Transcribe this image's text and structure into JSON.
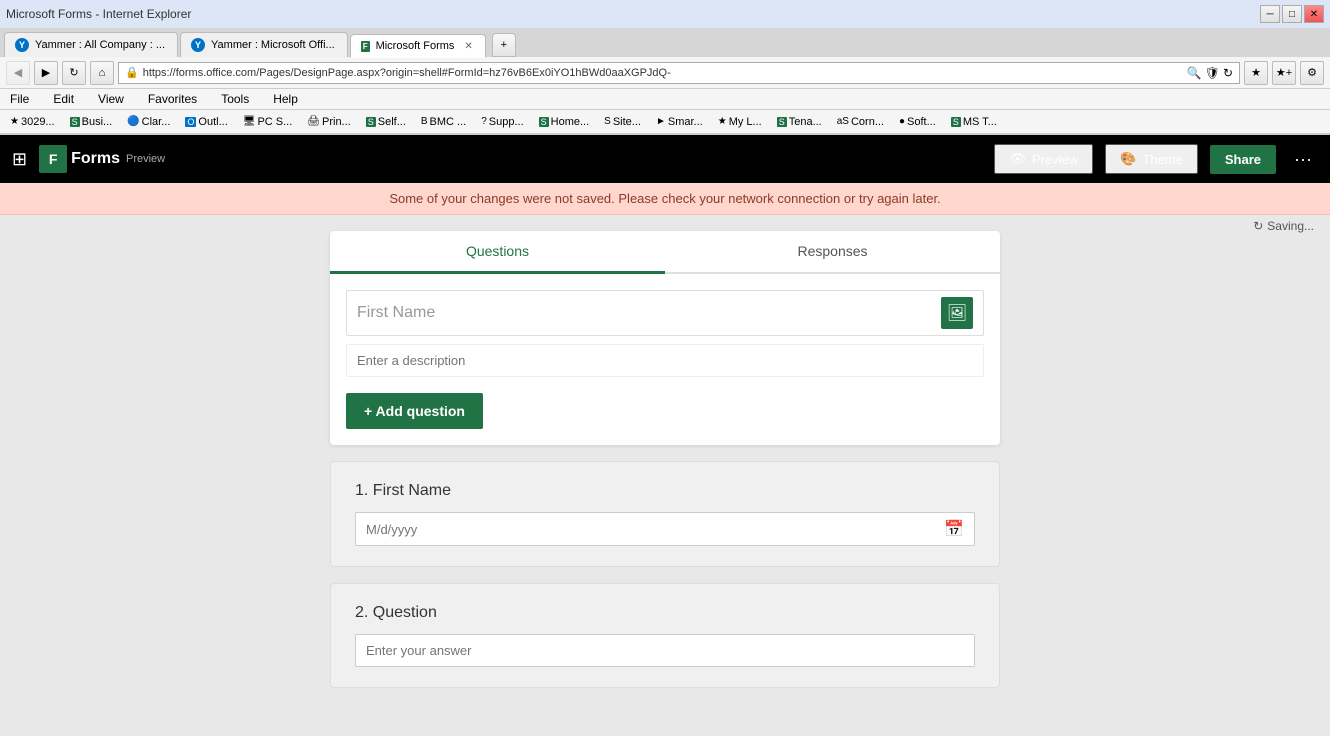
{
  "browser": {
    "title_bar": {
      "minimize": "─",
      "maximize": "□",
      "close": "✕"
    },
    "address": {
      "url": "https://forms.office.com/Pages/DesignPage.aspx?origin=shell#FormId=hz76vB6Ex0iYO1hBWd0aaXGPJdQ-",
      "lock_icon": "🔒"
    },
    "menu_items": [
      "File",
      "Edit",
      "View",
      "Favorites",
      "Tools",
      "Help"
    ],
    "bookmarks": [
      {
        "label": "3029...",
        "icon": "★"
      },
      {
        "label": "Busi...",
        "icon": "S"
      },
      {
        "label": "Clar...",
        "icon": "C"
      },
      {
        "label": "Outl...",
        "icon": "O"
      },
      {
        "label": "PC S...",
        "icon": "P"
      },
      {
        "label": "Prin...",
        "icon": "P"
      },
      {
        "label": "Self...",
        "icon": "S"
      },
      {
        "label": "BMC ...",
        "icon": "B"
      },
      {
        "label": "Supp...",
        "icon": "?"
      },
      {
        "label": "Home...",
        "icon": "S"
      },
      {
        "label": "Site...",
        "icon": "S"
      },
      {
        "label": "Smar...",
        "icon": "►"
      },
      {
        "label": "My L...",
        "icon": "★"
      },
      {
        "label": "Tena...",
        "icon": "S"
      },
      {
        "label": "Corn...",
        "icon": "aS"
      },
      {
        "label": "Soft...",
        "icon": "●"
      },
      {
        "label": "MS T...",
        "icon": "S"
      }
    ],
    "tabs": [
      {
        "label": "Yammer : All Company : ...",
        "type": "yammer",
        "active": false
      },
      {
        "label": "Yammer : Microsoft Offi...",
        "type": "yammer",
        "active": false
      },
      {
        "label": "Microsoft Forms",
        "type": "forms",
        "active": true
      }
    ]
  },
  "app_header": {
    "app_name": "Forms",
    "preview_badge": "Preview",
    "preview_btn": "Preview",
    "theme_btn": "Theme",
    "share_btn": "Share",
    "more_icon": "···"
  },
  "alert": {
    "message": "Some of your changes were not saved. Please check your network connection or try again later."
  },
  "form": {
    "tabs": [
      {
        "label": "Questions",
        "active": true
      },
      {
        "label": "Responses",
        "active": false
      }
    ],
    "question_editor": {
      "question_placeholder": "First Name",
      "description_placeholder": "Enter a description",
      "add_question_label": "+ Add question"
    },
    "preview_questions": [
      {
        "number": "1.",
        "label": "First Name",
        "type": "date",
        "date_placeholder": "M/d/yyyy"
      },
      {
        "number": "2.",
        "label": "Question",
        "type": "text",
        "text_placeholder": "Enter your answer"
      }
    ],
    "saving_status": "Saving..."
  }
}
